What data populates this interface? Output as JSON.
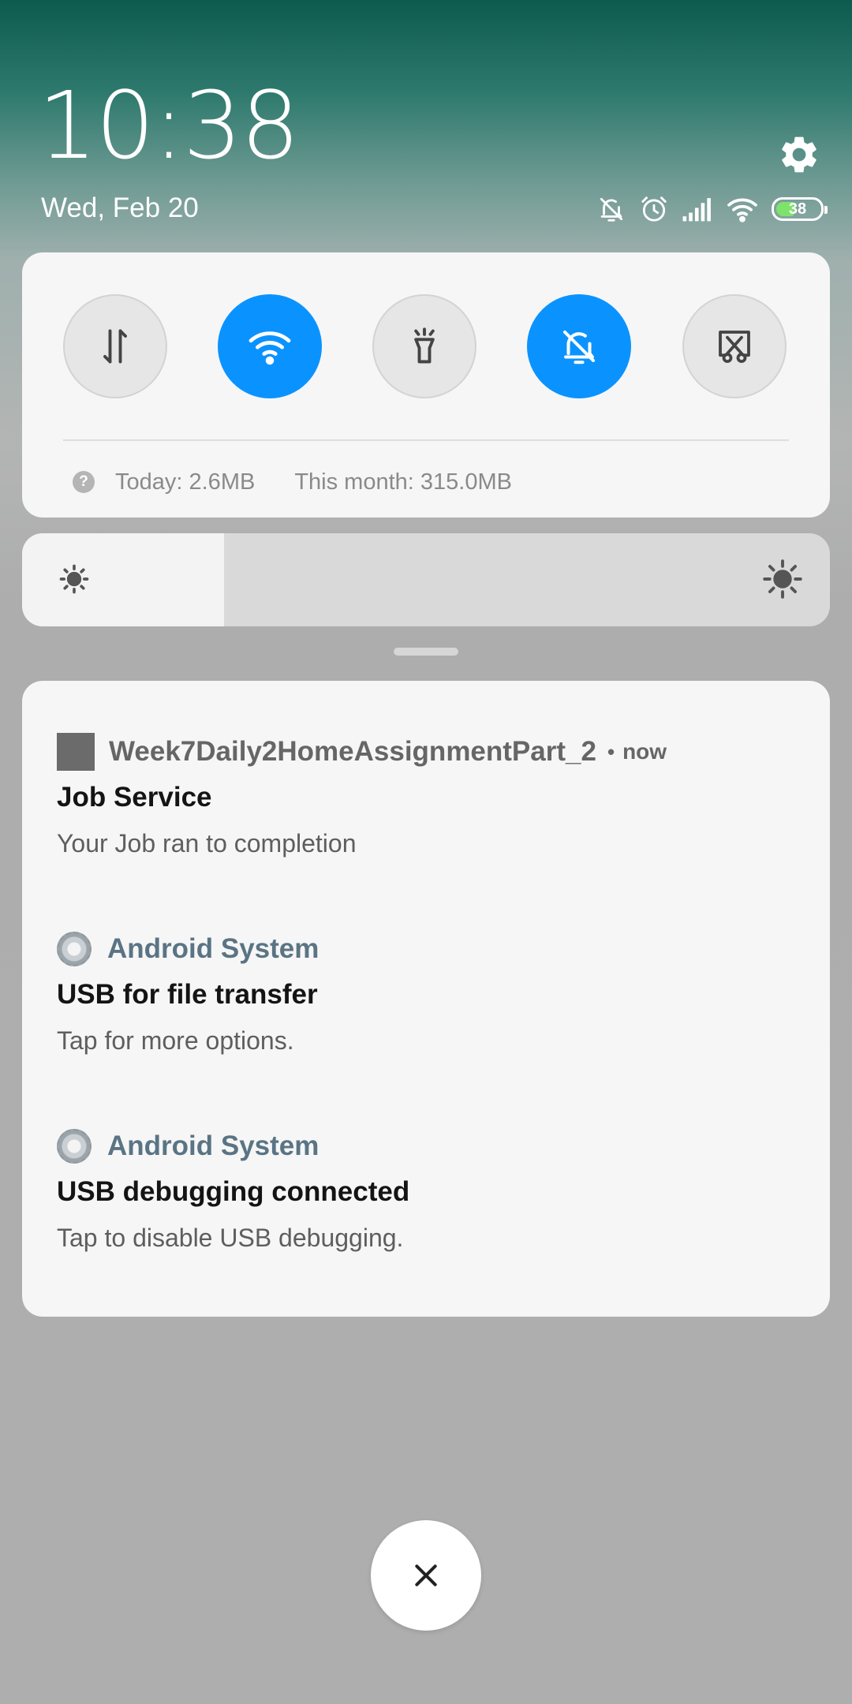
{
  "header": {
    "time": "10:38",
    "date": "Wed, Feb 20",
    "battery_level": "38"
  },
  "status_icons": [
    "silent-icon",
    "alarm-icon",
    "signal-icon",
    "wifi-icon",
    "battery-icon"
  ],
  "quick_settings": {
    "tiles": [
      {
        "name": "mobile-data",
        "icon": "data-transfer-icon",
        "active": false
      },
      {
        "name": "wifi",
        "icon": "wifi-icon",
        "active": true
      },
      {
        "name": "flashlight",
        "icon": "flashlight-icon",
        "active": false
      },
      {
        "name": "silent",
        "icon": "bell-off-icon",
        "active": true
      },
      {
        "name": "screenshot",
        "icon": "scissors-icon",
        "active": false
      }
    ],
    "usage_today": "Today: 2.6MB",
    "usage_month": "This month: 315.0MB"
  },
  "brightness": {
    "level": 0.25
  },
  "notifications": [
    {
      "app": "Week7Daily2HomeAssignmentPart_2",
      "time_sep": "•",
      "time": "now",
      "title": "Job Service",
      "text": "Your Job ran to completion"
    },
    {
      "app": "Android System",
      "title": "USB for file transfer",
      "text": "Tap for more options."
    },
    {
      "app": "Android System",
      "title": "USB debugging connected",
      "text": "Tap to disable USB debugging."
    }
  ],
  "colors": {
    "accent": "#0a93ff",
    "battery_fill": "#7ee36b",
    "system_app": "#5a7484"
  }
}
